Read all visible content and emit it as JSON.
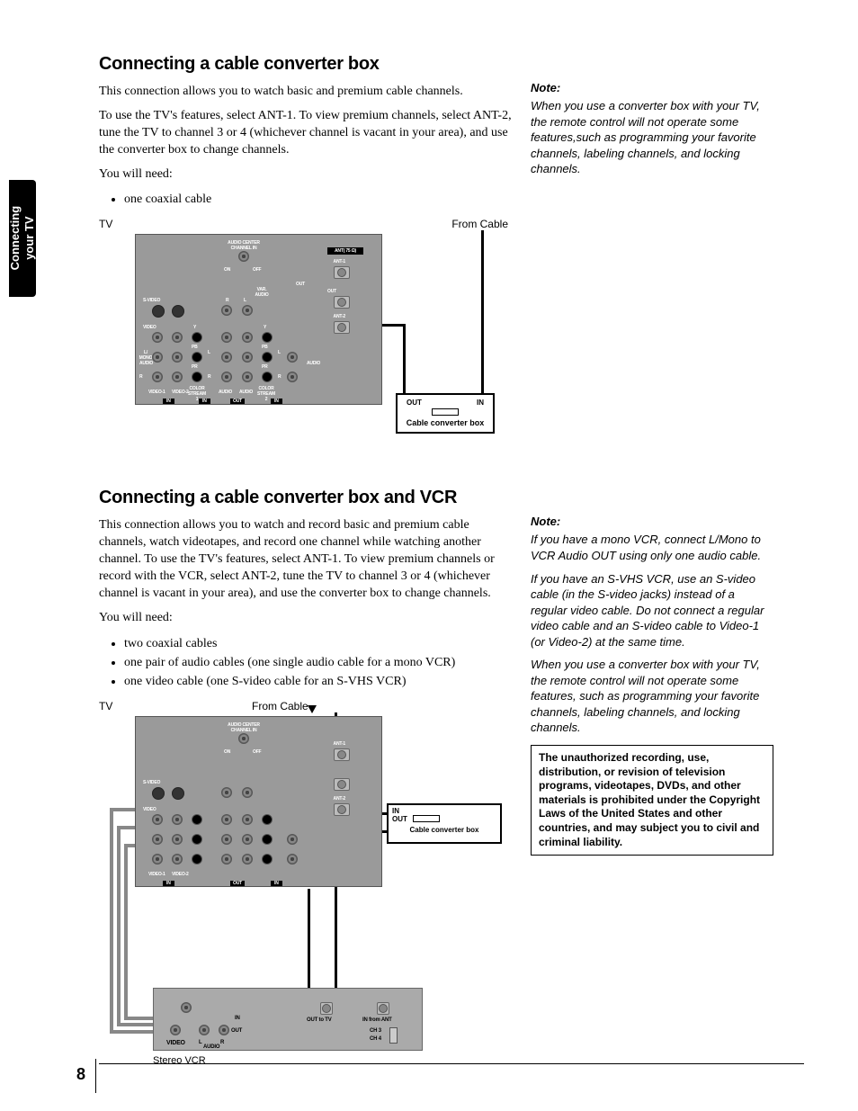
{
  "sideTab": {
    "line1": "Connecting",
    "line2": "your TV"
  },
  "section1": {
    "heading": "Connecting a cable converter box",
    "p1": "This connection allows you to watch basic and premium cable channels.",
    "p2": "To use the TV's features, select ANT-1. To view premium channels, select ANT-2, tune the TV to channel 3 or 4 (whichever channel is vacant in your area), and use the converter box to change channels.",
    "p3": "You will need:",
    "needs": [
      "one coaxial cable"
    ],
    "noteHeading": "Note:",
    "note1": "When you use a converter box with your TV, the remote control will not operate some features,such as programming your favorite channels, labeling channels, and locking channels.",
    "diagram": {
      "tvLabel": "TV",
      "fromCable": "From Cable",
      "converter": "Cable converter box",
      "out": "OUT",
      "in": "IN",
      "panel": {
        "audioCenter": "AUDIO CENTER\nCHANNEL IN",
        "on": "ON",
        "off": "OFF",
        "ant75": "ANT( 75 Ω)",
        "ant1": "ANT-1",
        "ant2": "ANT-2",
        "svideo": "S-VIDEO",
        "r": "R",
        "l": "L",
        "varAudio": "VAR.\nAUDIO",
        "outLbl": "OUT",
        "video": "VIDEO",
        "lmono": "L/\nMONO",
        "audio": "AUDIO",
        "y": "Y",
        "pb": "PB",
        "pr": "PR",
        "v1": "VIDEO-1",
        "v2": "VIDEO-2",
        "cs1": "COLOR\nSTREAM\n1",
        "cs2": "COLOR\nSTREAM\n2",
        "inLbl": "IN"
      }
    }
  },
  "section2": {
    "heading": "Connecting a cable converter box and VCR",
    "p1": "This connection allows you to watch and record basic and premium cable channels, watch videotapes, and record one channel while watching another channel. To use the TV's features, select ANT-1. To view premium channels or record with the VCR, select ANT-2, tune the TV to channel 3 or 4 (whichever channel is vacant in your area), and use the converter box to change channels.",
    "p2": "You will need:",
    "needs": [
      "two coaxial cables",
      "one pair of audio cables (one single audio cable for a mono VCR)",
      "one video cable (one S-video cable for an S-VHS VCR)"
    ],
    "noteHeading": "Note:",
    "note1": "If you have a mono VCR, connect L/Mono to VCR Audio OUT using only one audio cable.",
    "note2": "If you have an S-VHS VCR, use an S-video cable (in the S-video jacks) instead of a regular video cable. Do not connect a regular video cable and an S-video cable to Video-1 (or Video-2) at the same time.",
    "note3": "When you use a converter box with your TV, the remote control will not operate some features, such as programming your favorite channels, labeling channels, and locking channels.",
    "warning": "The unauthorized recording, use, distribution, or revision of television programs, videotapes, DVDs, and other materials is prohibited under the Copyright Laws of the United States and other countries, and may subject you to civil and criminal liability.",
    "diagram": {
      "tvLabel": "TV",
      "fromCable": "From Cable",
      "converter": "Cable converter box",
      "in": "IN",
      "out": "OUT",
      "vcrLabel": "Stereo VCR",
      "outToTV": "OUT to TV",
      "inFromAnt": "IN from ANT",
      "ch3": "CH 3",
      "ch4": "CH 4",
      "videoLbl": "VIDEO",
      "audioLbl": "AUDIO",
      "l": "L",
      "r": "R"
    }
  },
  "pageNumber": "8"
}
